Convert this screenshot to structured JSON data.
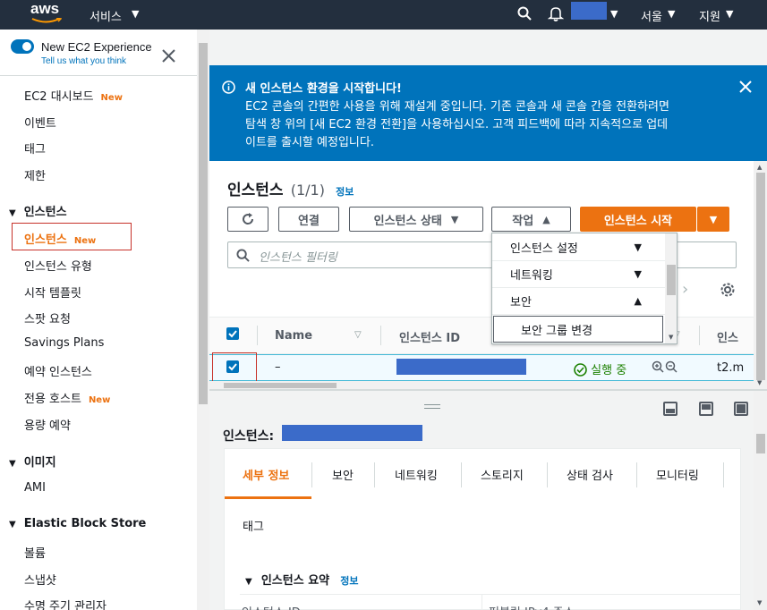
{
  "topnav": {
    "logo": "aws",
    "services": "서비스",
    "region": "서울",
    "support": "지원",
    "icons": [
      "search-icon",
      "bell-icon"
    ]
  },
  "sidebar": {
    "toggle_title": "New EC2 Experience",
    "toggle_sub": "Tell us what you think",
    "new_badge": "New",
    "items_top": [
      {
        "label": "EC2 대시보드",
        "new": true
      },
      {
        "label": "이벤트",
        "new": false
      },
      {
        "label": "태그",
        "new": false
      },
      {
        "label": "제한",
        "new": false
      }
    ],
    "section_instances": "인스턴스",
    "instances_items": [
      {
        "label": "인스턴스",
        "new": true,
        "active": true
      },
      {
        "label": "인스턴스 유형",
        "new": false
      },
      {
        "label": "시작 템플릿",
        "new": false
      },
      {
        "label": "스팟 요청",
        "new": false
      },
      {
        "label": "Savings Plans",
        "new": false
      },
      {
        "label": "예약 인스턴스",
        "new": false
      },
      {
        "label": "전용 호스트",
        "new": true
      },
      {
        "label": "용량 예약",
        "new": false
      }
    ],
    "section_images": "이미지",
    "images_items": [
      "AMI"
    ],
    "section_ebs": "Elastic Block Store",
    "ebs_items": [
      "볼륨",
      "스냅샷",
      "수명 주기 관리자"
    ]
  },
  "flash": {
    "title": "새 인스턴스 환경을 시작합니다!",
    "line1": "EC2 콘솔의 간편한 사용을 위해 재설계 중입니다. 기존 콘솔과 새 콘솔 간을 전환하려면",
    "line2": "탐색 창 위의 [새 EC2 환경 전환]을 사용하십시오. 고객 피드백에 따라 지속적으로 업데",
    "line3": "이트를 출시할 예정입니다."
  },
  "instances": {
    "heading": "인스턴스",
    "count": "(1/1)",
    "info": "정보",
    "btn_connect": "연결",
    "btn_state": "인스턴스 상태",
    "btn_actions": "작업",
    "btn_launch": "인스턴스 시작",
    "filter_placeholder": "인스턴스 필터링",
    "actions_menu": [
      "인스턴스 설정",
      "네트워킹",
      "보안",
      "보안 그룹 변경"
    ],
    "table": {
      "col_name": "Name",
      "col_id": "인스턴스 ID",
      "col_type_partial": "인스",
      "row": {
        "name": "–",
        "status": "실행 중",
        "type_partial": "t2.m"
      }
    }
  },
  "details": {
    "title": "인스턴스:",
    "tabs": [
      "세부 정보",
      "보안",
      "네트워킹",
      "스토리지",
      "상태 검사",
      "모니터링"
    ],
    "tab_tags": "태그",
    "section_summary": "인스턴스 요약",
    "summary_info": "정보",
    "field_left_partial": "인스턴스 ID",
    "field_right_partial": "퍼블릭 IPv4 주소"
  },
  "colors": {
    "nav_bg": "#232f3e",
    "flash_bg": "#0073bb",
    "accent_orange": "#ec7211",
    "link_blue": "#0073bb",
    "success_green": "#1d8102",
    "redacted_blue": "#3b6bc9"
  }
}
